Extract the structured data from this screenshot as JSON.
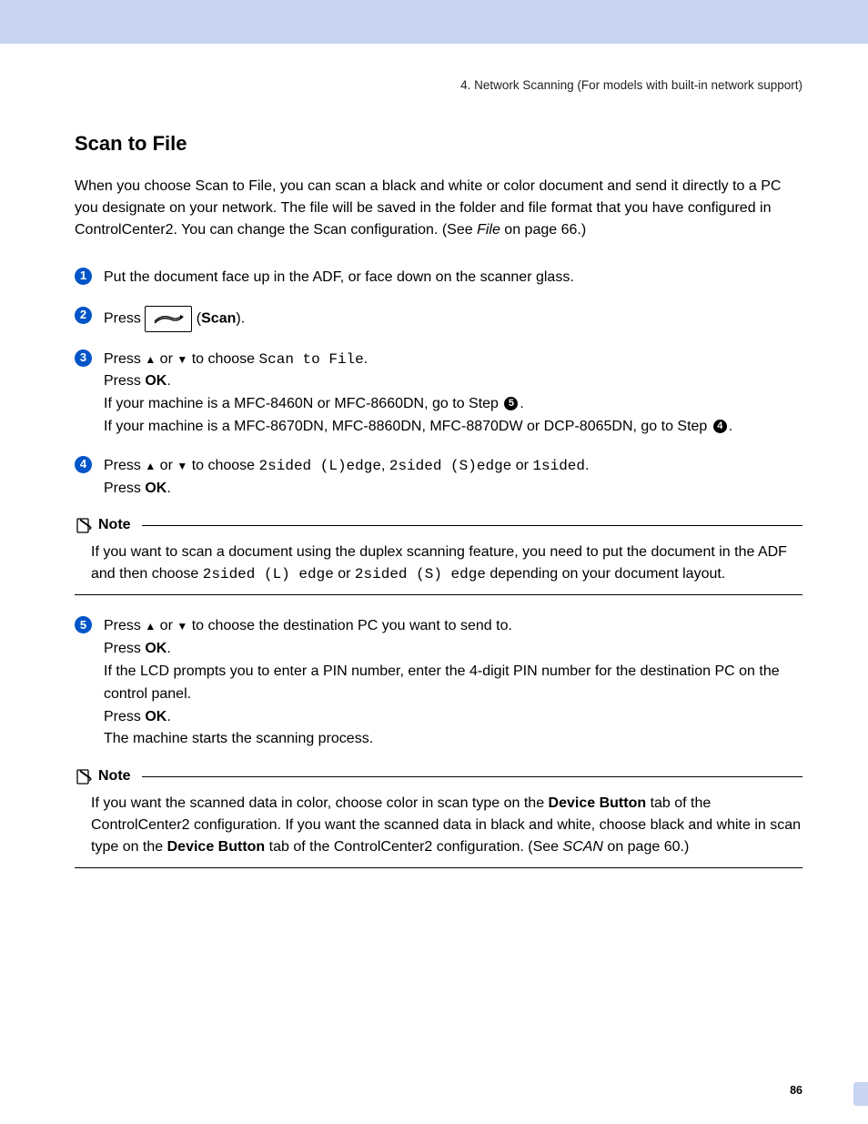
{
  "header": "4. Network Scanning (For models with  built-in network support)",
  "title": "Scan to File",
  "intro": {
    "t1": "When you choose Scan to File, you can scan a black and white or color document and send it directly to a PC you designate on your network. The file will be saved in the folder and file format that you have configured in ControlCenter2. You can change the Scan configuration. (See ",
    "link": "File",
    "t2": " on page 66.)"
  },
  "steps": {
    "s1": "Put the document face up in the ADF, or face down on the scanner glass.",
    "s2": {
      "a": "Press ",
      "b": " (",
      "c": "Scan",
      "d": ")."
    },
    "s3": {
      "a": "Press ",
      "b": " or ",
      "c": " to choose ",
      "m": "Scan to File",
      "d": ".",
      "e": "Press ",
      "ok": "OK",
      "f": ".",
      "g": "If your machine is a MFC-8460N or MFC-8660DN, go to Step ",
      "r1": "5",
      "h": ".",
      "i": "If your machine is a MFC-8670DN, MFC-8860DN, MFC-8870DW or DCP-8065DN, go to Step ",
      "r2": "4",
      "j": "."
    },
    "s4": {
      "a": "Press ",
      "b": " or ",
      "c": " to choose ",
      "m1": "2sided (L)edge",
      "comma": ", ",
      "m2": "2sided (S)edge",
      "or": " or ",
      "m3": "1sided",
      "d": ".",
      "e": "Press ",
      "ok": "OK",
      "f": "."
    },
    "s5": {
      "a": "Press ",
      "b": " or ",
      "c": " to choose the destination PC you want to send to.",
      "e": "Press ",
      "ok": "OK",
      "f": ".",
      "g": "If the LCD prompts you to enter a PIN number, enter the 4-digit PIN number for the destination PC on the control panel.",
      "h": "Press ",
      "ok2": "OK",
      "i": ".",
      "j": "The machine starts the scanning process."
    }
  },
  "notes": {
    "label": "Note",
    "n1": {
      "a": "If you want to scan a document using the duplex scanning feature, you need to put the document in the ADF and then choose ",
      "m1": "2sided (L) edge",
      "or": " or ",
      "m2": "2sided (S) edge",
      "b": " depending on your document layout."
    },
    "n2": {
      "a": "If you want the scanned data in color, choose color in scan type on the ",
      "b1": "Device Button",
      "b": " tab of the ControlCenter2 configuration. If you want the scanned data in black and white, choose black and white in scan type on the ",
      "b2": "Device Button",
      "c": " tab of the ControlCenter2 configuration. (See ",
      "link": "SCAN",
      "d": " on page 60.)"
    }
  },
  "page_number": "86"
}
